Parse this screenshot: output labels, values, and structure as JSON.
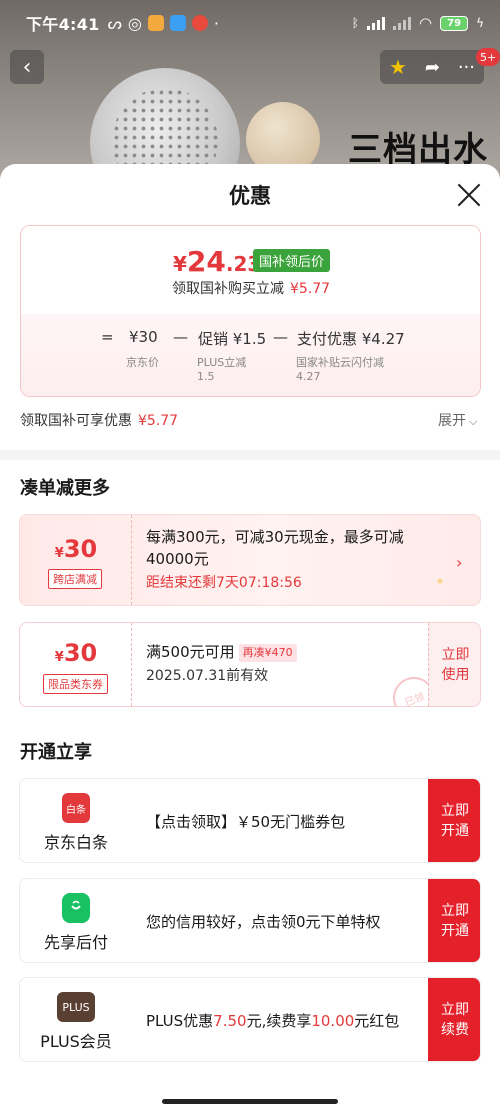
{
  "statusbar": {
    "time": "下午4:41",
    "battery": "79"
  },
  "hero": {
    "text": "三档出水",
    "badge": "5+"
  },
  "sheet": {
    "title": "优惠",
    "price": {
      "yen": "¥",
      "main": "24",
      "decimal": ".23",
      "tag": "国补领后价",
      "subtitle": "领取国补购买立减",
      "subtitle_amount": "¥5.77"
    },
    "formula": {
      "eq": "=",
      "jd_price": "¥30",
      "minus1": "—",
      "promo": "促销 ¥1.5",
      "minus2": "—",
      "pay_discount": "支付优惠 ¥4.27",
      "label_jd": "京东价",
      "label_plus": "PLUS立减",
      "value_plus": "1.5",
      "label_gov": "国家补贴云闪付减",
      "value_gov": "4.27"
    },
    "summary": {
      "text": "领取国补可享优惠",
      "amount": "¥5.77",
      "expand": "展开"
    }
  },
  "more_discounts": {
    "title": "凑单减更多",
    "coupon1": {
      "yen": "¥",
      "amount": "30",
      "tag": "跨店满减",
      "line1": "每满300元，可减30元现金，最多可减",
      "line2": "40000元",
      "countdown": "距结束还剩7天07:18:56"
    },
    "coupon2": {
      "yen": "¥",
      "amount": "30",
      "tag": "限品类东券",
      "condition": "满500元可用",
      "extra_tag": "再凑¥470",
      "expiry": "2025.07.31前有效",
      "use1": "立即",
      "use2": "使用",
      "stamp": "已领"
    }
  },
  "open_services": {
    "title": "开通立享",
    "items": [
      {
        "name": "京东白条",
        "icon_label": "白条",
        "desc": "【点击领取】￥50无门槛券包",
        "btn1": "立即",
        "btn2": "开通",
        "color": "#e4393c"
      },
      {
        "name": "先享后付",
        "icon_label": "",
        "desc": "您的信用较好，点击领0元下单特权",
        "btn1": "立即",
        "btn2": "开通",
        "color": "#18c263"
      },
      {
        "name": "PLUS会员",
        "icon_label": "PLUS",
        "desc_a": "PLUS优惠",
        "desc_b": "7.50",
        "desc_c": "元,续费享",
        "desc_d": "10.00",
        "desc_e": "元红包",
        "btn1": "立即",
        "btn2": "续费",
        "color": "#5a4032"
      }
    ]
  }
}
